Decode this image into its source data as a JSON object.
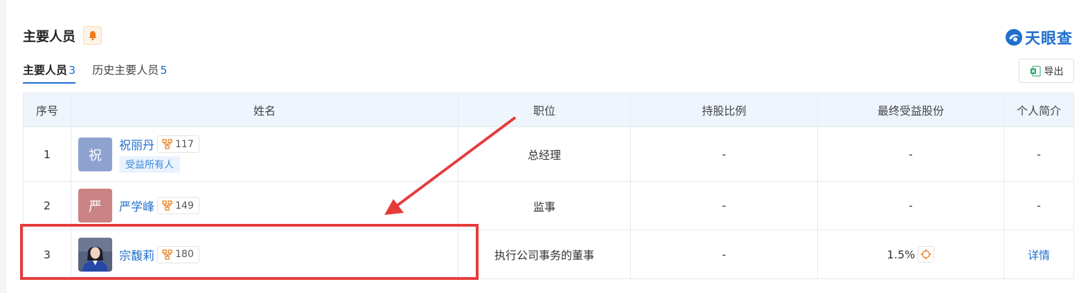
{
  "section": {
    "title": "主要人员"
  },
  "brand": {
    "name": "天眼查"
  },
  "tabs": [
    {
      "label": "主要人员",
      "count": "3",
      "active": true
    },
    {
      "label": "历史主要人员",
      "count": "5",
      "active": false
    }
  ],
  "toolbar": {
    "export_label": "导出"
  },
  "table": {
    "headers": [
      "序号",
      "姓名",
      "职位",
      "持股比例",
      "最终受益股份",
      "个人简介"
    ],
    "rows": [
      {
        "index": "1",
        "avatar_char": "祝",
        "avatar_color": "#8da2cf",
        "name": "祝丽丹",
        "relation_count": "117",
        "tag": "受益所有人",
        "position": "总经理",
        "shareholding": "-",
        "beneficial_shares": "-",
        "profile": "-"
      },
      {
        "index": "2",
        "avatar_char": "严",
        "avatar_color": "#c98383",
        "name": "严学峰",
        "relation_count": "149",
        "tag": "",
        "position": "监事",
        "shareholding": "-",
        "beneficial_shares": "-",
        "profile": "-"
      },
      {
        "index": "3",
        "avatar_char": "",
        "avatar_color": "#4a5a78",
        "name": "宗馥莉",
        "relation_count": "180",
        "tag": "",
        "position": "执行公司事务的董事",
        "shareholding": "-",
        "beneficial_shares": "1.5%",
        "profile": "详情"
      }
    ]
  },
  "colors": {
    "accent": "#1f6fce",
    "highlight": "#e63b3b",
    "relation_icon": "#e8852a"
  }
}
